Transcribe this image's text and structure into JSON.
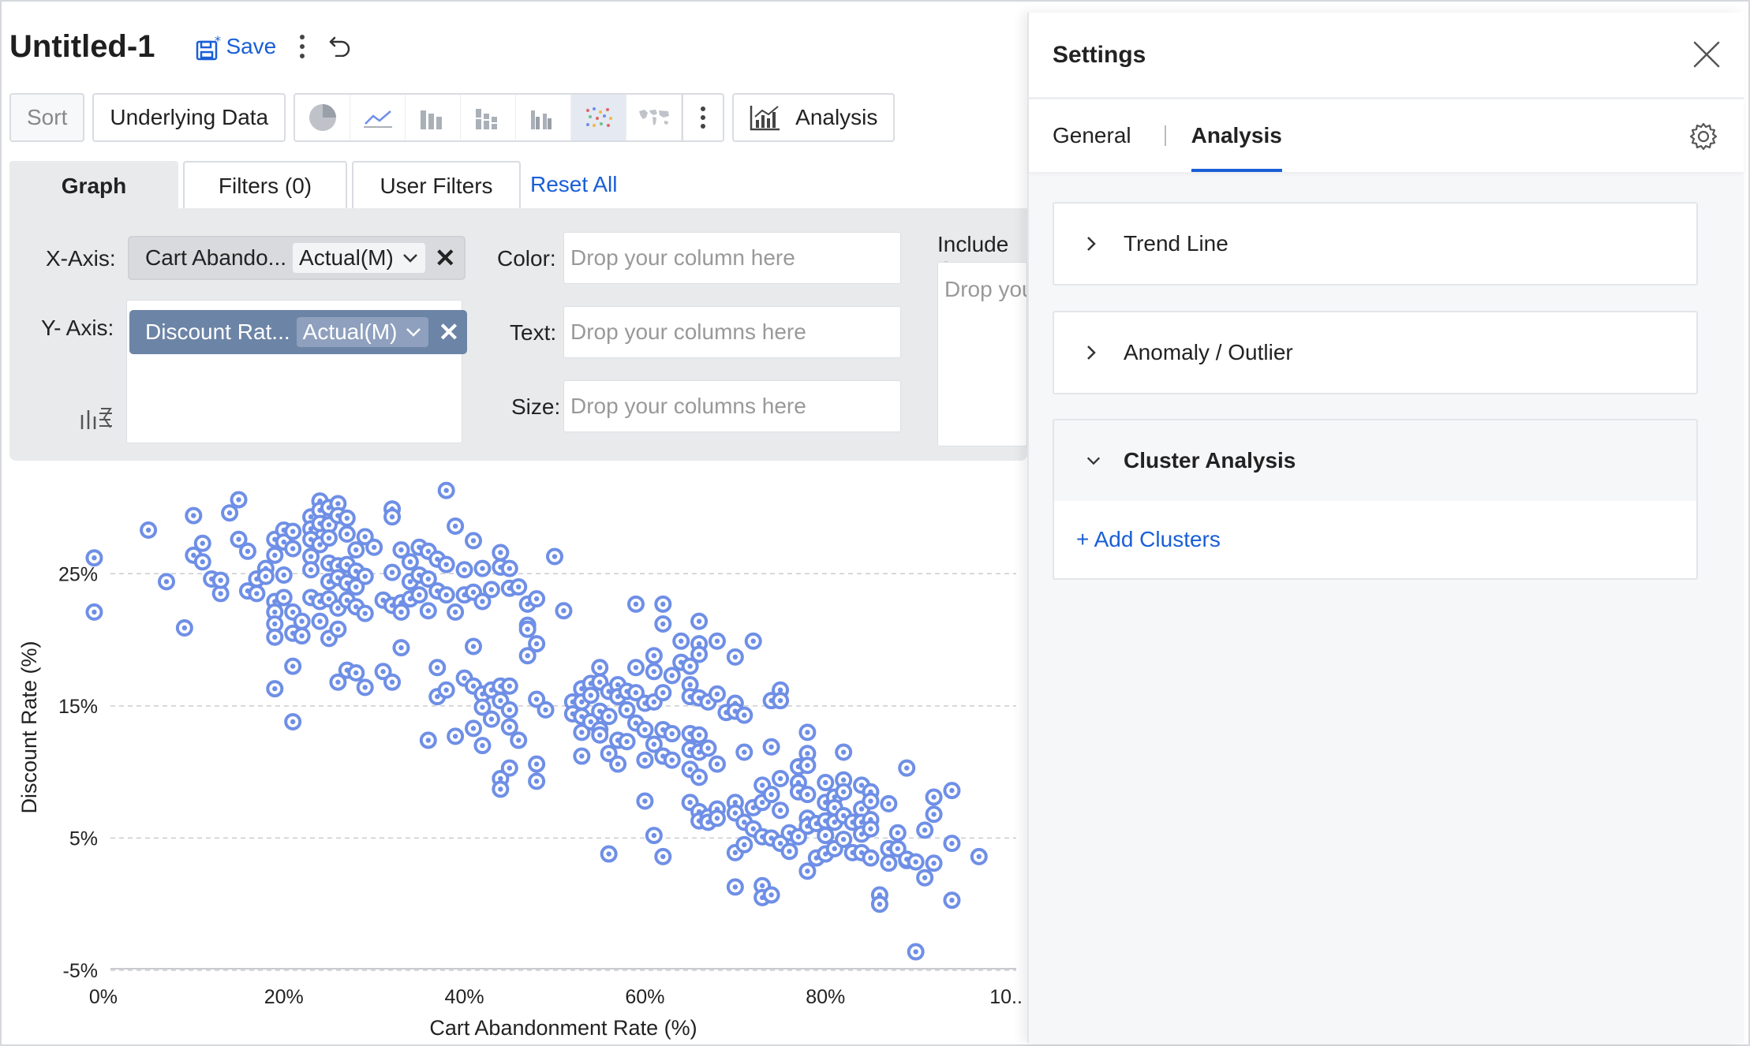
{
  "header": {
    "title": "Untitled-1",
    "save_label": "Save"
  },
  "toolbar": {
    "sort_label": "Sort",
    "underlying_data_label": "Underlying Data",
    "analysis_label": "Analysis",
    "chart_types": [
      "pie-chart-icon",
      "line-chart-icon",
      "bar-chart-icon",
      "stacked-bar-icon",
      "grouped-bar-icon",
      "scatter-chart-icon",
      "map-chart-icon"
    ],
    "active_chart_type": "scatter-chart-icon"
  },
  "tabs": {
    "graph": "Graph",
    "filters": "Filters  (0)",
    "user_filters": "User Filters",
    "reset_all": "Reset All"
  },
  "shelf": {
    "x_axis_label": "X-Axis:",
    "y_axis_label": "Y- Axis:",
    "x_field": "Cart Abando...",
    "x_agg": "Actual(M)",
    "y_field": "Discount Rat...",
    "y_agg": "Actual(M)",
    "color_label": "Color:",
    "color_placeholder": "Drop your column here",
    "text_label": "Text:",
    "text_placeholder": "Drop your columns here",
    "size_label": "Size:",
    "size_placeholder": "Drop your columns here",
    "include_label": "Include C",
    "include_placeholder": "Drop you"
  },
  "settings": {
    "title": "Settings",
    "tabs": [
      "General",
      "Analysis"
    ],
    "active_tab": "Analysis",
    "sections": [
      {
        "label": "Trend Line",
        "expanded": false
      },
      {
        "label": "Anomaly / Outlier",
        "expanded": false
      },
      {
        "label": "Cluster Analysis",
        "expanded": true
      }
    ],
    "add_clusters_label": "+ Add Clusters"
  },
  "colors": {
    "accent": "#1a5fd6",
    "point": "#6f8fe6",
    "y_pill": "#6c84a6"
  },
  "chart_data": {
    "type": "scatter",
    "xlabel": "Cart Abandonment Rate (%)",
    "ylabel": "Discount Rate (%)",
    "xlim": [
      -2,
      102
    ],
    "ylim": [
      -5,
      32
    ],
    "xticks": [
      0,
      20,
      40,
      60,
      80,
      100
    ],
    "xtick_labels": [
      "0%",
      "20%",
      "40%",
      "60%",
      "80%",
      "10.."
    ],
    "yticks": [
      -5,
      5,
      15,
      25
    ],
    "ytick_labels": [
      "-5%",
      "5%",
      "15%",
      "25%"
    ],
    "grid": "horizontal-dashed",
    "points": [
      [
        -1,
        26.2
      ],
      [
        -1,
        22.1
      ],
      [
        5,
        28.3
      ],
      [
        7,
        24.4
      ],
      [
        9,
        20.9
      ],
      [
        10,
        29.4
      ],
      [
        10,
        26.4
      ],
      [
        11,
        27.3
      ],
      [
        11,
        25.9
      ],
      [
        12,
        24.6
      ],
      [
        13,
        23.5
      ],
      [
        13,
        24.5
      ],
      [
        14,
        29.6
      ],
      [
        15,
        30.6
      ],
      [
        15,
        27.6
      ],
      [
        16,
        26.7
      ],
      [
        16,
        23.7
      ],
      [
        17,
        23.5
      ],
      [
        17,
        24.6
      ],
      [
        18,
        25.4
      ],
      [
        18,
        24.8
      ],
      [
        19,
        27.6
      ],
      [
        19,
        26.4
      ],
      [
        19,
        22.9
      ],
      [
        19,
        22.1
      ],
      [
        19,
        21.2
      ],
      [
        19,
        20.2
      ],
      [
        19,
        16.3
      ],
      [
        20,
        28.3
      ],
      [
        20,
        27.4
      ],
      [
        20,
        24.9
      ],
      [
        20,
        23.2
      ],
      [
        21,
        28.2
      ],
      [
        21,
        26.9
      ],
      [
        21,
        22.1
      ],
      [
        21,
        20.5
      ],
      [
        21,
        18.0
      ],
      [
        21,
        13.8
      ],
      [
        22,
        21.4
      ],
      [
        22,
        20.3
      ],
      [
        23,
        29.3
      ],
      [
        23,
        28.4
      ],
      [
        23,
        27.6
      ],
      [
        23,
        26.3
      ],
      [
        23,
        25.3
      ],
      [
        23,
        23.2
      ],
      [
        24,
        30.5
      ],
      [
        24,
        29.8
      ],
      [
        24,
        28.8
      ],
      [
        24,
        27.2
      ],
      [
        24,
        22.9
      ],
      [
        24,
        21.4
      ],
      [
        25,
        30.0
      ],
      [
        25,
        28.7
      ],
      [
        25,
        27.7
      ],
      [
        25,
        25.8
      ],
      [
        25,
        24.4
      ],
      [
        25,
        23.1
      ],
      [
        25,
        20.1
      ],
      [
        26,
        30.3
      ],
      [
        26,
        29.4
      ],
      [
        26,
        25.6
      ],
      [
        26,
        24.7
      ],
      [
        26,
        22.4
      ],
      [
        26,
        20.8
      ],
      [
        26,
        16.8
      ],
      [
        27,
        29.2
      ],
      [
        27,
        28.0
      ],
      [
        27,
        25.7
      ],
      [
        27,
        24.3
      ],
      [
        27,
        23.0
      ],
      [
        27,
        17.7
      ],
      [
        28,
        26.8
      ],
      [
        28,
        25.2
      ],
      [
        28,
        24.0
      ],
      [
        28,
        22.5
      ],
      [
        28,
        17.5
      ],
      [
        29,
        27.8
      ],
      [
        29,
        24.8
      ],
      [
        29,
        22.0
      ],
      [
        29,
        16.4
      ],
      [
        30,
        27.0
      ],
      [
        31,
        23.0
      ],
      [
        31,
        17.6
      ],
      [
        32,
        29.9
      ],
      [
        32,
        29.3
      ],
      [
        32,
        25.1
      ],
      [
        32,
        22.6
      ],
      [
        32,
        16.8
      ],
      [
        33,
        26.8
      ],
      [
        33,
        22.8
      ],
      [
        33,
        22.1
      ],
      [
        33,
        19.4
      ],
      [
        34,
        25.9
      ],
      [
        34,
        24.4
      ],
      [
        34,
        23.1
      ],
      [
        35,
        27.0
      ],
      [
        35,
        24.9
      ],
      [
        35,
        23.4
      ],
      [
        36,
        26.7
      ],
      [
        36,
        24.6
      ],
      [
        36,
        22.2
      ],
      [
        36,
        12.4
      ],
      [
        37,
        26.1
      ],
      [
        37,
        23.7
      ],
      [
        37,
        17.9
      ],
      [
        37,
        15.7
      ],
      [
        38,
        31.3
      ],
      [
        38,
        25.7
      ],
      [
        38,
        23.4
      ],
      [
        38,
        16.2
      ],
      [
        39,
        28.6
      ],
      [
        39,
        22.1
      ],
      [
        39,
        12.7
      ],
      [
        40,
        25.3
      ],
      [
        40,
        23.4
      ],
      [
        40,
        17.1
      ],
      [
        41,
        27.5
      ],
      [
        41,
        23.6
      ],
      [
        41,
        19.5
      ],
      [
        41,
        16.5
      ],
      [
        41,
        13.3
      ],
      [
        42,
        25.4
      ],
      [
        42,
        22.9
      ],
      [
        42,
        15.9
      ],
      [
        42,
        14.9
      ],
      [
        42,
        12.0
      ],
      [
        43,
        23.8
      ],
      [
        43,
        16.2
      ],
      [
        43,
        14.0
      ],
      [
        44,
        26.6
      ],
      [
        44,
        25.5
      ],
      [
        44,
        16.5
      ],
      [
        44,
        15.4
      ],
      [
        44,
        9.5
      ],
      [
        44,
        8.7
      ],
      [
        45,
        25.4
      ],
      [
        45,
        23.9
      ],
      [
        45,
        16.5
      ],
      [
        45,
        14.7
      ],
      [
        45,
        13.4
      ],
      [
        45,
        10.3
      ],
      [
        46,
        24.0
      ],
      [
        46,
        12.4
      ],
      [
        47,
        22.7
      ],
      [
        47,
        21.1
      ],
      [
        47,
        20.8
      ],
      [
        47,
        18.8
      ],
      [
        48,
        23.1
      ],
      [
        48,
        19.7
      ],
      [
        48,
        15.5
      ],
      [
        48,
        10.6
      ],
      [
        48,
        9.3
      ],
      [
        49,
        14.7
      ],
      [
        50,
        26.3
      ],
      [
        51,
        22.2
      ],
      [
        52,
        15.3
      ],
      [
        52,
        14.4
      ],
      [
        53,
        16.3
      ],
      [
        53,
        15.3
      ],
      [
        53,
        14.2
      ],
      [
        53,
        13.0
      ],
      [
        53,
        11.2
      ],
      [
        54,
        16.7
      ],
      [
        54,
        15.8
      ],
      [
        54,
        13.8
      ],
      [
        55,
        17.9
      ],
      [
        55,
        16.8
      ],
      [
        55,
        14.6
      ],
      [
        55,
        13.2
      ],
      [
        55,
        12.8
      ],
      [
        56,
        16.1
      ],
      [
        56,
        14.2
      ],
      [
        56,
        11.4
      ],
      [
        56,
        3.8
      ],
      [
        57,
        16.6
      ],
      [
        57,
        15.7
      ],
      [
        57,
        12.4
      ],
      [
        57,
        10.6
      ],
      [
        58,
        16.1
      ],
      [
        58,
        14.7
      ],
      [
        58,
        12.3
      ],
      [
        59,
        22.7
      ],
      [
        59,
        17.9
      ],
      [
        59,
        16.0
      ],
      [
        59,
        13.7
      ],
      [
        60,
        15.2
      ],
      [
        60,
        13.2
      ],
      [
        60,
        10.9
      ],
      [
        60,
        7.8
      ],
      [
        61,
        18.8
      ],
      [
        61,
        17.6
      ],
      [
        61,
        15.3
      ],
      [
        61,
        12.1
      ],
      [
        61,
        5.2
      ],
      [
        62,
        22.7
      ],
      [
        62,
        21.2
      ],
      [
        62,
        16.0
      ],
      [
        62,
        13.2
      ],
      [
        62,
        11.2
      ],
      [
        62,
        3.6
      ],
      [
        63,
        17.3
      ],
      [
        63,
        12.9
      ],
      [
        63,
        10.9
      ],
      [
        64,
        19.9
      ],
      [
        64,
        18.3
      ],
      [
        65,
        18.0
      ],
      [
        65,
        16.6
      ],
      [
        65,
        15.7
      ],
      [
        65,
        12.9
      ],
      [
        65,
        11.7
      ],
      [
        65,
        10.2
      ],
      [
        65,
        7.7
      ],
      [
        66,
        21.4
      ],
      [
        66,
        19.7
      ],
      [
        66,
        18.9
      ],
      [
        66,
        15.6
      ],
      [
        66,
        12.8
      ],
      [
        66,
        11.5
      ],
      [
        66,
        9.6
      ],
      [
        66,
        7.0
      ],
      [
        66,
        6.3
      ],
      [
        67,
        15.3
      ],
      [
        67,
        11.8
      ],
      [
        67,
        6.6
      ],
      [
        67,
        6.2
      ],
      [
        68,
        19.9
      ],
      [
        68,
        15.9
      ],
      [
        68,
        10.6
      ],
      [
        68,
        7.2
      ],
      [
        68,
        6.5
      ],
      [
        69,
        14.5
      ],
      [
        70,
        18.7
      ],
      [
        70,
        15.2
      ],
      [
        70,
        14.6
      ],
      [
        70,
        7.7
      ],
      [
        70,
        6.9
      ],
      [
        70,
        3.9
      ],
      [
        70,
        1.3
      ],
      [
        71,
        14.3
      ],
      [
        71,
        11.5
      ],
      [
        71,
        6.2
      ],
      [
        71,
        4.5
      ],
      [
        72,
        19.9
      ],
      [
        72,
        7.3
      ],
      [
        72,
        5.7
      ],
      [
        73,
        9.0
      ],
      [
        73,
        7.7
      ],
      [
        73,
        5.1
      ],
      [
        73,
        1.4
      ],
      [
        73,
        0.5
      ],
      [
        74,
        15.4
      ],
      [
        74,
        11.9
      ],
      [
        74,
        8.3
      ],
      [
        74,
        5.0
      ],
      [
        74,
        0.7
      ],
      [
        75,
        16.2
      ],
      [
        75,
        15.4
      ],
      [
        75,
        9.5
      ],
      [
        75,
        7.1
      ],
      [
        75,
        4.6
      ],
      [
        76,
        5.4
      ],
      [
        76,
        4.0
      ],
      [
        77,
        10.4
      ],
      [
        77,
        9.2
      ],
      [
        77,
        8.5
      ],
      [
        77,
        5.1
      ],
      [
        78,
        13.0
      ],
      [
        78,
        11.4
      ],
      [
        78,
        10.5
      ],
      [
        78,
        8.3
      ],
      [
        78,
        6.5
      ],
      [
        78,
        5.9
      ],
      [
        78,
        2.5
      ],
      [
        79,
        6.1
      ],
      [
        79,
        3.5
      ],
      [
        80,
        9.2
      ],
      [
        80,
        7.7
      ],
      [
        80,
        6.3
      ],
      [
        80,
        5.2
      ],
      [
        80,
        3.8
      ],
      [
        81,
        8.1
      ],
      [
        81,
        7.3
      ],
      [
        81,
        6.2
      ],
      [
        81,
        4.2
      ],
      [
        82,
        11.5
      ],
      [
        82,
        9.4
      ],
      [
        82,
        8.5
      ],
      [
        82,
        6.7
      ],
      [
        82,
        4.9
      ],
      [
        83,
        6.2
      ],
      [
        83,
        3.9
      ],
      [
        84,
        9.0
      ],
      [
        84,
        7.2
      ],
      [
        84,
        6.2
      ],
      [
        84,
        5.3
      ],
      [
        84,
        3.9
      ],
      [
        85,
        8.5
      ],
      [
        85,
        7.8
      ],
      [
        85,
        6.4
      ],
      [
        85,
        5.7
      ],
      [
        85,
        3.5
      ],
      [
        86,
        0.7
      ],
      [
        86,
        0.0
      ],
      [
        87,
        4.2
      ],
      [
        87,
        3.1
      ],
      [
        87,
        7.6
      ],
      [
        88,
        5.4
      ],
      [
        88,
        4.2
      ],
      [
        89,
        10.3
      ],
      [
        89,
        3.3
      ],
      [
        89,
        3.4
      ],
      [
        90,
        3.2
      ],
      [
        90,
        -3.6
      ],
      [
        91,
        2.0
      ],
      [
        91,
        5.6
      ],
      [
        92,
        8.1
      ],
      [
        92,
        6.8
      ],
      [
        92,
        3.1
      ],
      [
        94,
        8.6
      ],
      [
        94,
        4.6
      ],
      [
        94,
        0.3
      ],
      [
        97,
        3.6
      ]
    ]
  }
}
